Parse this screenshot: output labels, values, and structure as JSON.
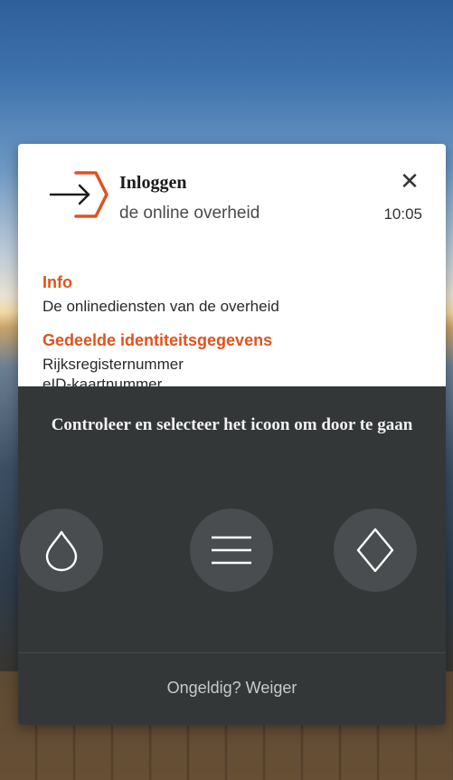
{
  "header": {
    "title": "Inloggen",
    "subtitle": "de online overheid",
    "time": "10:05",
    "logo_icon": "login-arrow-hexagon-icon",
    "close_icon": "close-icon",
    "close_glyph": "✕"
  },
  "details": {
    "info_heading": "Info",
    "info_text": "De onlinediensten van de overheid",
    "shared_heading": "Gedeelde identiteitsgegevens",
    "shared_items": [
      "Rijksregisternummer",
      "eID-kaartnummer"
    ]
  },
  "verification": {
    "instruction": "Controleer en selecteer het icoon om door te gaan",
    "choices": [
      {
        "icon": "drop-icon"
      },
      {
        "icon": "menu-lines-icon"
      },
      {
        "icon": "diamond-icon"
      }
    ],
    "reject_label": "Ongeldig? Weiger"
  },
  "colors": {
    "accent": "#e0531f",
    "dark_panel": "#343738",
    "choice_bg": "#4a4d4f"
  }
}
